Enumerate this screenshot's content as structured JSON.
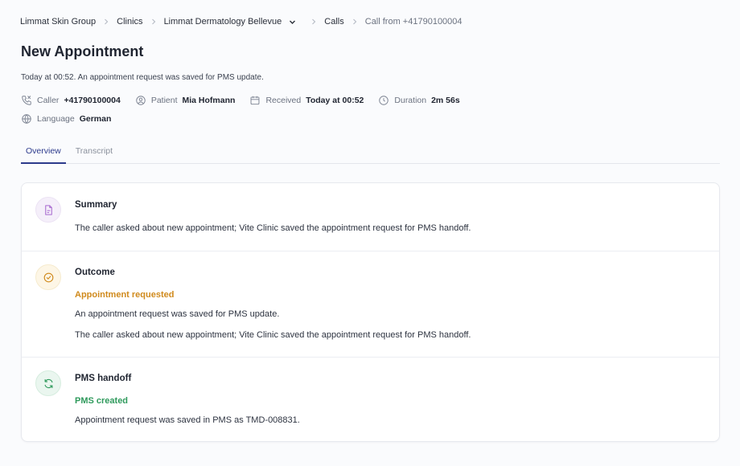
{
  "breadcrumb": {
    "items": [
      "Limmat Skin Group",
      "Clinics",
      "Limmat Dermatology Bellevue",
      "Calls"
    ],
    "current": "Call from +41790100004"
  },
  "header": {
    "title": "New Appointment",
    "subtitle": "Today at 00:52. An appointment request was saved for PMS update."
  },
  "meta": {
    "caller_label": "Caller",
    "caller_value": "+41790100004",
    "patient_label": "Patient",
    "patient_value": "Mia Hofmann",
    "received_label": "Received",
    "received_value": "Today at 00:52",
    "duration_label": "Duration",
    "duration_value": "2m 56s",
    "language_label": "Language",
    "language_value": "German"
  },
  "tabs": [
    "Overview",
    "Transcript"
  ],
  "sections": {
    "summary": {
      "title": "Summary",
      "text": "The caller asked about new appointment; Vite Clinic saved the appointment request for PMS handoff."
    },
    "outcome": {
      "title": "Outcome",
      "status": "Appointment requested",
      "text1": "An appointment request was saved for PMS update.",
      "text2": "The caller asked about new appointment; Vite Clinic saved the appointment request for PMS handoff."
    },
    "pms": {
      "title": "PMS handoff",
      "status": "PMS created",
      "text": "Appointment request was saved in PMS as TMD-008831."
    }
  },
  "colors": {
    "accent": "#2c3a8c",
    "outcome_status": "#d08a1c",
    "pms_status": "#2f9a5c"
  },
  "icons": [
    "phone-icon",
    "user-icon",
    "calendar-icon",
    "clock-icon",
    "globe-icon",
    "document-icon",
    "check-circle-icon",
    "refresh-icon"
  ]
}
